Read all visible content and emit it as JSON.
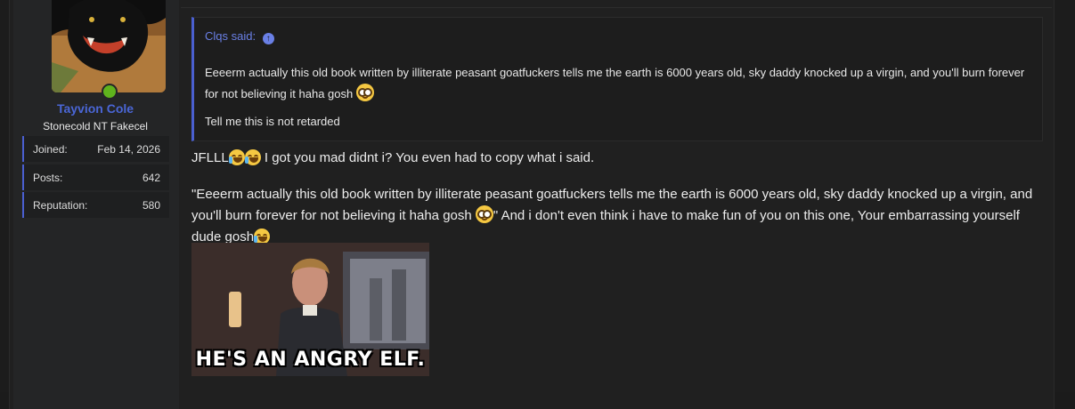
{
  "user": {
    "name": "Tayvion Cole",
    "title": "Stonecold NT Fakecel",
    "stats": [
      {
        "label": "Joined:",
        "value": "Feb 14, 2026"
      },
      {
        "label": "Posts:",
        "value": "642"
      },
      {
        "label": "Reputation:",
        "value": "580"
      }
    ],
    "online": true
  },
  "quote": {
    "author_line": "Clqs said:",
    "line1": "Eeeerm actually this old book written by illiterate peasant goatfuckers tells me the earth is 6000 years old, sky daddy knocked up a virgin, and you'll burn forever for not believing it haha gosh",
    "line2": "Tell me this is not retarded"
  },
  "message": {
    "p1_prefix": "JFLLL",
    "p1_text": " I got you mad didnt i? You even had to copy what i said.",
    "p2_text": "\"Eeeerm actually this old book written by illiterate peasant goatfuckers tells me the earth is 6000 years old, sky daddy knocked up a virgin, and you'll burn forever for not believing it haha gosh",
    "p2_tail": "\" And i don't even think i have to make fun of you on this one, Your embarrassing yourself dude gosh"
  },
  "gif": {
    "caption": "HE'S AN ANGRY ELF."
  },
  "colors": {
    "accent": "#4a5fd0",
    "username": "#4a66d6",
    "online": "#5fb31d"
  }
}
